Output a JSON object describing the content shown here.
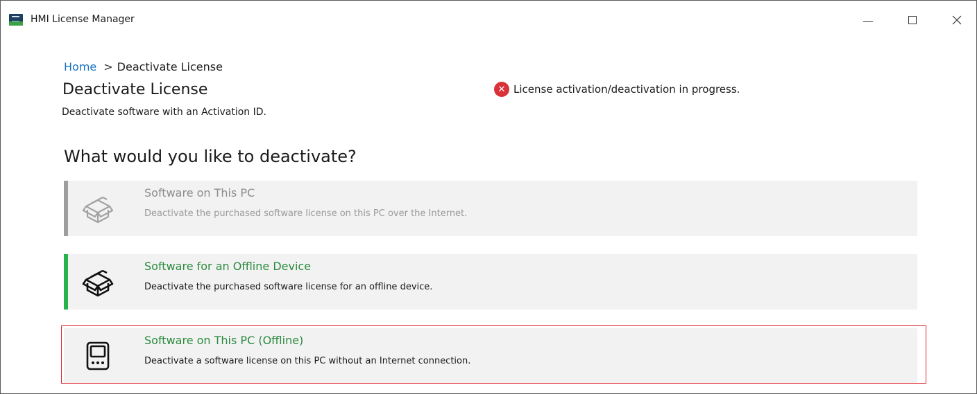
{
  "window": {
    "title": "HMI License Manager",
    "controls": {
      "minimize": "minimize",
      "maximize": "maximize",
      "close": "✕"
    }
  },
  "breadcrumb": {
    "home": "Home",
    "separator": ">",
    "current": "Deactivate License"
  },
  "page": {
    "title": "Deactivate License",
    "subtitle": "Deactivate software with an Activation ID.",
    "question": "What would you like to deactivate?"
  },
  "status": {
    "icon": "error-icon",
    "icon_glyph": "✕",
    "text": "License activation/deactivation in progress.",
    "color": "#d9333a"
  },
  "options": [
    {
      "title": "Software on This PC",
      "description": "Deactivate the purchased software license on this PC over the Internet.",
      "icon": "package-icon",
      "state": "disabled"
    },
    {
      "title": "Software for an Offline Device",
      "description": "Deactivate the purchased software license for an offline device.",
      "icon": "package-icon",
      "state": "enabled"
    },
    {
      "title": "Software on This PC (Offline)",
      "description": "Deactivate a software license on this PC without an Internet connection.",
      "icon": "device-icon",
      "state": "enabled",
      "highlighted": true
    }
  ],
  "colors": {
    "link": "#1a73c2",
    "accent_green": "#27b24a",
    "title_green": "#2a8a3e",
    "highlight_red": "#e0262a"
  }
}
